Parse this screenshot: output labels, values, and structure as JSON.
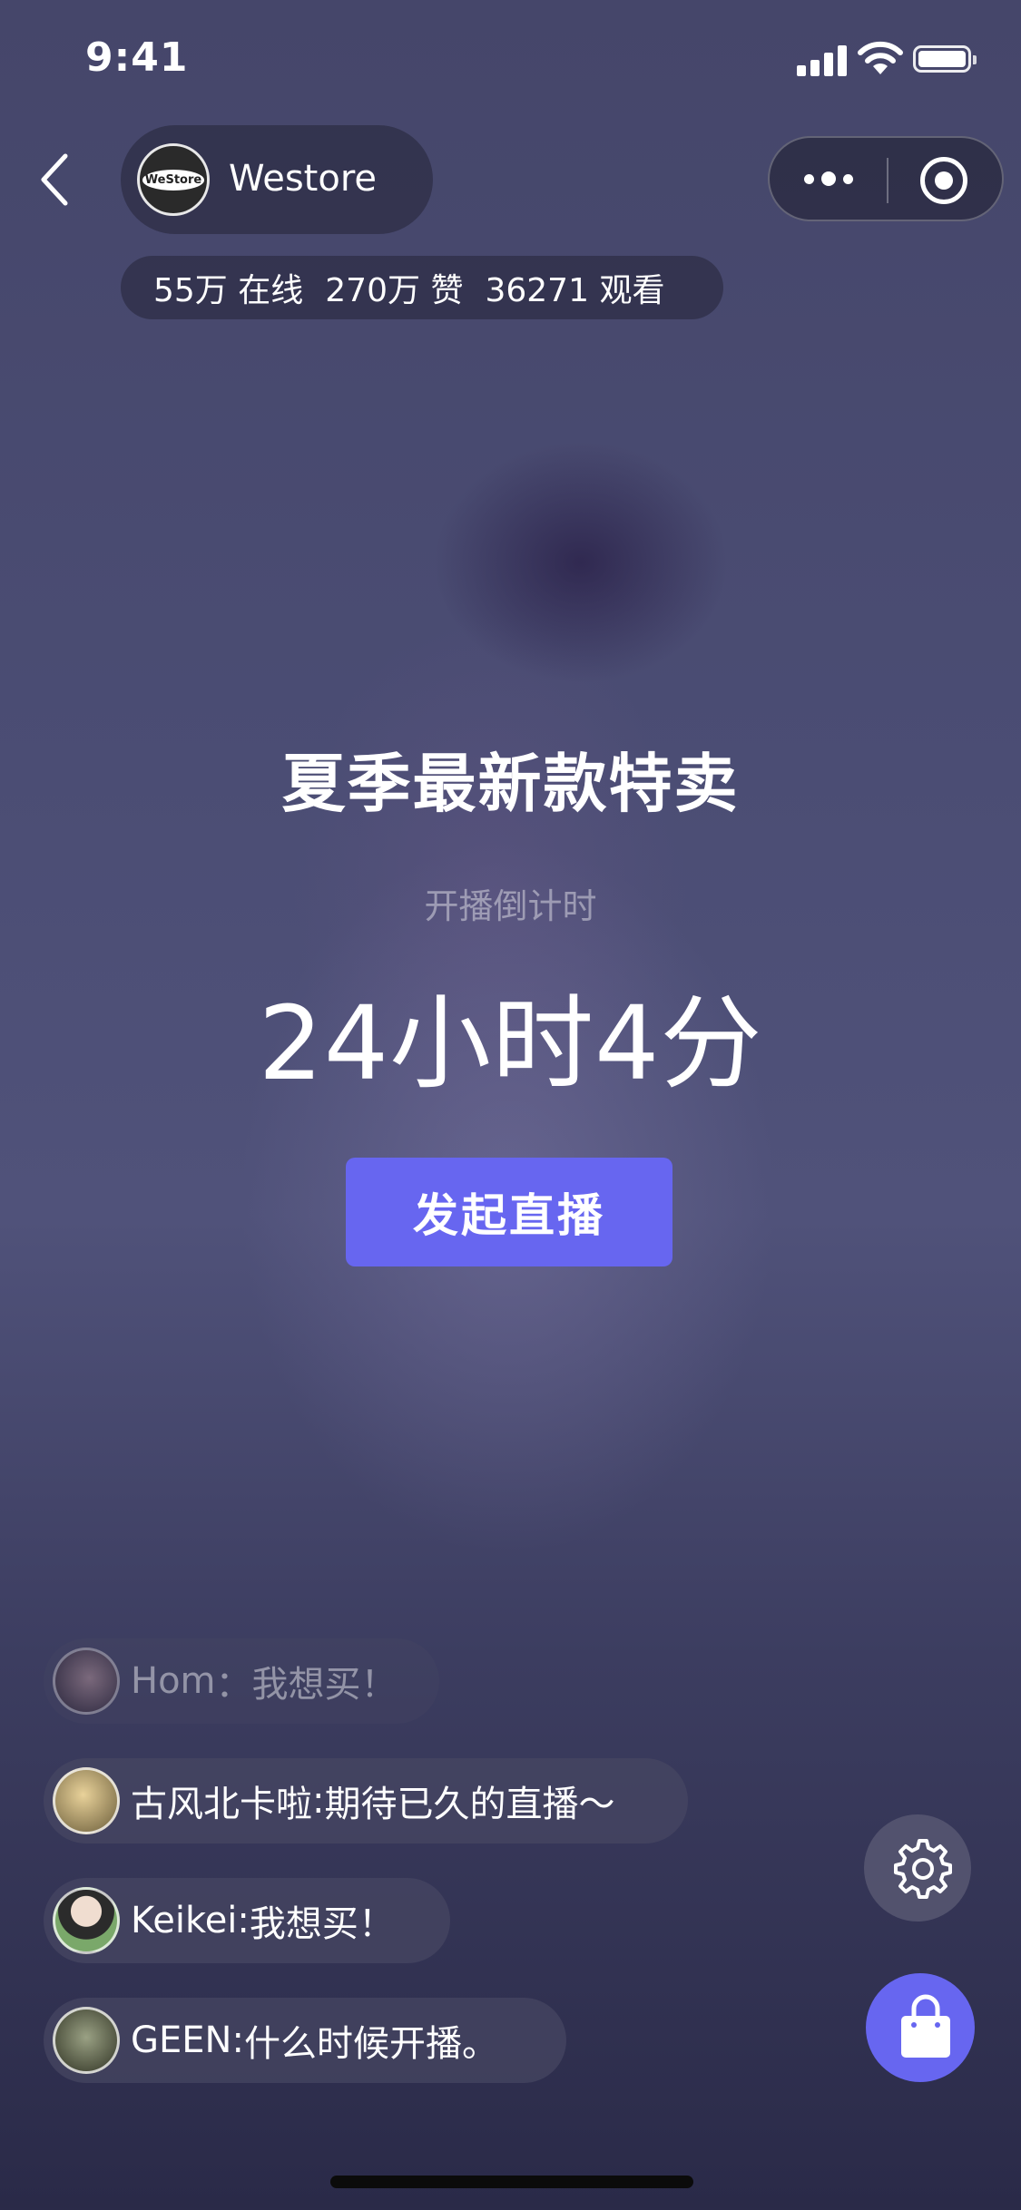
{
  "status_bar": {
    "time": "9:41"
  },
  "header": {
    "shop_logo": "WeStore",
    "shop_name": "Westore",
    "stats": [
      {
        "value": "55万",
        "label": "在线"
      },
      {
        "value": "270万",
        "label": "赞"
      },
      {
        "value": "36271",
        "label": "观看"
      }
    ]
  },
  "main": {
    "title": "夏季最新款特卖",
    "countdown_label": "开播倒计时",
    "countdown_value": "24小时4分",
    "start_button": "发起直播"
  },
  "comments": [
    {
      "user": "Hom",
      "sep": "：",
      "text": "我想买！"
    },
    {
      "user": "古风北卡啦",
      "sep": ":",
      "text": "期待已久的直播～"
    },
    {
      "user": "Keikei",
      "sep": ":",
      "text": "我想买！"
    },
    {
      "user": "GEEN",
      "sep": ":",
      "text": "什么时候开播。"
    }
  ],
  "icons": [
    "back-icon",
    "more-icon",
    "record-icon",
    "gear-icon",
    "shopping-bag-icon"
  ],
  "colors": {
    "accent": "#6766F0"
  }
}
